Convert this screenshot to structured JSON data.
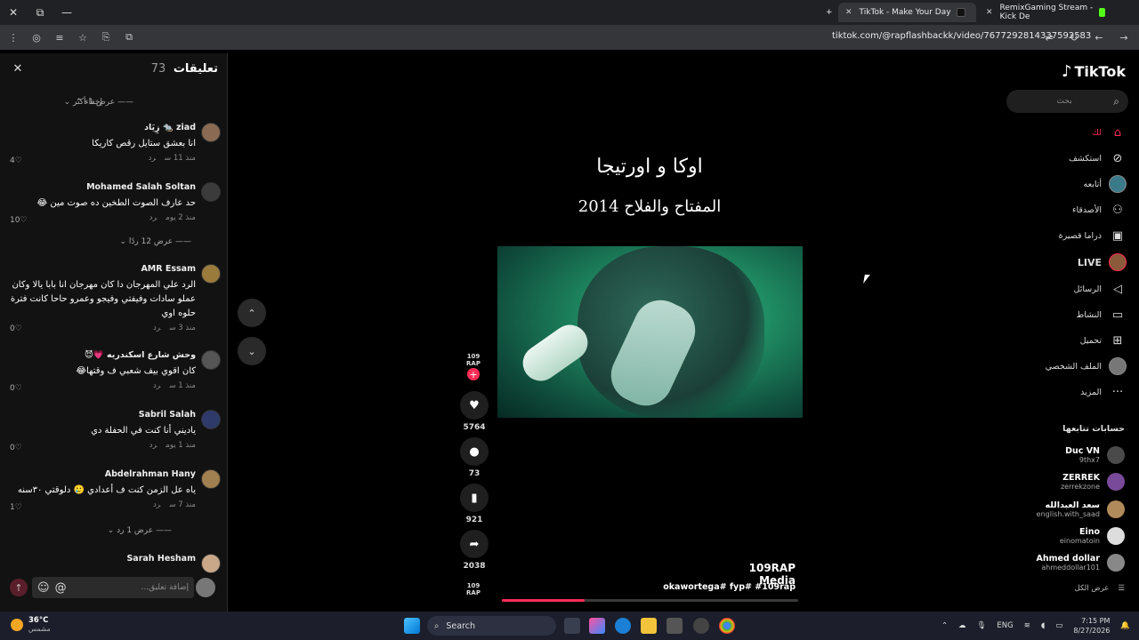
{
  "browser": {
    "tabs": [
      {
        "title": "TikTok - Make Your Day",
        "active": true
      },
      {
        "title": "RemixGaming Stream - Kick De",
        "active": false
      }
    ],
    "url": "tiktok.com/@rapflashbackk/video/7677292814337592583"
  },
  "comments": {
    "title": "تعليقات",
    "count": "73",
    "hide_label": "إخفاء",
    "more_label": "عرض 1 أكثر",
    "items": [
      {
        "user": "ziad 🐀 زِيَاد",
        "text": "انا بعشق ستايل رقص كاريكا",
        "time": "منذ 11 س",
        "reply": "رد",
        "likes": "4"
      },
      {
        "user": "Mohamed Salah Soltan",
        "text": "حد عارف الصوت الطخين ده صوت مين 😂",
        "time": "منذ 2 يوم",
        "reply": "رد",
        "likes": "10",
        "thread": "عرض 12 ردًا"
      },
      {
        "user": "AMR Essam",
        "text": "الرد علي المهرجان دا كان مهرجان انا بابا يالا وكان عملو سادات وفيفتي وفيجو وعمرو حاحا كانت فترة حلوه اوي",
        "time": "منذ 3 س",
        "reply": "رد",
        "likes": "0"
      },
      {
        "user": "وحش شارع اسكندريه 💗😈",
        "text": "كان اقوي بيف شعبي ف وقتها😂",
        "time": "منذ 1 س",
        "reply": "رد",
        "likes": "0"
      },
      {
        "user": "Sabril Salah",
        "text": "ياديني أنا كنت في الحفلة دي",
        "time": "منذ 1 يوم",
        "reply": "رد",
        "likes": "0"
      },
      {
        "user": "Abdelrahman Hany",
        "text": "ياه عل الزمن كنت ف أعدادي 🥲 دلوقتي ٣٠سنه",
        "time": "منذ 7 س",
        "reply": "رد",
        "likes": "1",
        "thread": "عرض 1 رد"
      },
      {
        "user": "Sarah Hesham"
      }
    ],
    "input_placeholder": "إضافة تعليق..."
  },
  "video": {
    "title_line1": "اوكا و اورتيجا",
    "title_line2": "المفتاح والفلاح 2014",
    "author": "109RAP Media",
    "hashtags": "okawortega# fyp# #109rap",
    "progress": 0.28,
    "rail_logo": "109 RAP",
    "likes": "5764",
    "comments": "73",
    "saves": "921",
    "shares": "2038"
  },
  "sidebar": {
    "brand": "TikTok",
    "search_placeholder": "بحث",
    "nav": [
      {
        "label": "لك",
        "icon": "home-icon"
      },
      {
        "label": "استكشف",
        "icon": "compass-icon"
      },
      {
        "label": "أتابعه",
        "icon": "following-avatar"
      },
      {
        "label": "الأصدقاء",
        "icon": "friends-icon"
      },
      {
        "label": "دراما قصيرة",
        "icon": "drama-icon"
      },
      {
        "label": "LIVE",
        "icon": "live-avatar"
      },
      {
        "label": "الرسائل",
        "icon": "send-icon"
      },
      {
        "label": "النشاط",
        "icon": "chat-icon"
      },
      {
        "label": "تحميل",
        "icon": "upload-icon"
      },
      {
        "label": "الملف الشخصي",
        "icon": "profile-avatar"
      },
      {
        "label": "المزيد",
        "icon": "more-icon"
      }
    ],
    "following_header": "حسابات تتابعها",
    "following": [
      {
        "name": "Duc VN",
        "handle": "9thx7"
      },
      {
        "name": "ZERREK",
        "handle": "zerrekzone"
      },
      {
        "name": "سعد العبدالله",
        "handle": "english.with_saad"
      },
      {
        "name": "Eino",
        "handle": "einomatoin"
      },
      {
        "name": "Ahmed dollar",
        "handle": "ahmeddollar101"
      }
    ],
    "see_all": "عرض الكل"
  },
  "taskbar": {
    "temp": "36°C",
    "weather": "مشمس",
    "search": "Search",
    "lang": "ENG",
    "time": "7:15 PM",
    "date": "8/27/2026"
  },
  "colors": {
    "accent": "#fe2c55",
    "panel": "#121212"
  }
}
